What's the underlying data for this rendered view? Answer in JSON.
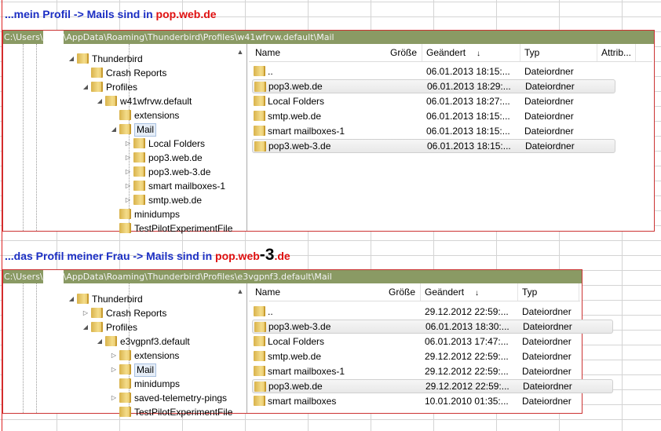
{
  "panels": [
    {
      "heading": {
        "text": "...mein Profil -> Mails sind in ",
        "highlight": "pop.web.de",
        "big": "",
        "tail": ""
      },
      "path": {
        "prefix": "C:\\Users\\",
        "suffix": "\\AppData\\Roaming\\Thunderbird\\Profiles\\w41wfrvw.default\\Mail"
      },
      "tree": [
        {
          "label": "Thunderbird",
          "level": 0,
          "arrow": "▲"
        },
        {
          "label": "Crash Reports",
          "level": 1,
          "arrow": ""
        },
        {
          "label": "Profiles",
          "level": 1,
          "arrow": "▲"
        },
        {
          "label": "w41wfrvw.default",
          "level": 2,
          "arrow": "▲"
        },
        {
          "label": "extensions",
          "level": 3,
          "arrow": ""
        },
        {
          "label": "Mail",
          "level": 3,
          "arrow": "▲",
          "selected": true
        },
        {
          "label": "Local Folders",
          "level": 4,
          "arrow": "▷"
        },
        {
          "label": "pop3.web.de",
          "level": 4,
          "arrow": "▷"
        },
        {
          "label": "pop3.web-3.de",
          "level": 4,
          "arrow": "▷"
        },
        {
          "label": "smart mailboxes-1",
          "level": 4,
          "arrow": "▷"
        },
        {
          "label": "smtp.web.de",
          "level": 4,
          "arrow": "▷"
        },
        {
          "label": "minidumps",
          "level": 3,
          "arrow": ""
        },
        {
          "label": "TestPilotExperimentFile",
          "level": 3,
          "arrow": ""
        }
      ],
      "columns": [
        "Name",
        "Größe",
        "Geändert",
        "Typ",
        "Attrib..."
      ],
      "sort_icon": "↓",
      "rows": [
        {
          "name": "..",
          "date": "06.01.2013 18:15:...",
          "type": "Dateiordner"
        },
        {
          "name": "pop3.web.de",
          "date": "06.01.2013 18:29:...",
          "type": "Dateiordner",
          "selected": true
        },
        {
          "name": "Local Folders",
          "date": "06.01.2013 18:27:...",
          "type": "Dateiordner"
        },
        {
          "name": "smtp.web.de",
          "date": "06.01.2013 18:15:...",
          "type": "Dateiordner"
        },
        {
          "name": "smart mailboxes-1",
          "date": "06.01.2013 18:15:...",
          "type": "Dateiordner"
        },
        {
          "name": "pop3.web-3.de",
          "date": "06.01.2013 18:15:...",
          "type": "Dateiordner",
          "selected": true
        }
      ]
    },
    {
      "heading": {
        "text": "...das Profil meiner Frau -> Mails sind in ",
        "highlight": "pop.web",
        "big": "-3",
        "tail": ".de"
      },
      "path": {
        "prefix": "C:\\Users\\",
        "suffix": "\\AppData\\Roaming\\Thunderbird\\Profiles\\e3vgpnf3.default\\Mail"
      },
      "tree": [
        {
          "label": "Thunderbird",
          "level": 0,
          "arrow": "▲"
        },
        {
          "label": "Crash Reports",
          "level": 1,
          "arrow": "▷"
        },
        {
          "label": "Profiles",
          "level": 1,
          "arrow": "▲"
        },
        {
          "label": "e3vgpnf3.default",
          "level": 2,
          "arrow": "▲"
        },
        {
          "label": "extensions",
          "level": 3,
          "arrow": "▷"
        },
        {
          "label": "Mail",
          "level": 3,
          "arrow": "▷",
          "selected": true
        },
        {
          "label": "minidumps",
          "level": 3,
          "arrow": ""
        },
        {
          "label": "saved-telemetry-pings",
          "level": 3,
          "arrow": "▷"
        },
        {
          "label": "TestPilotExperimentFile",
          "level": 3,
          "arrow": ""
        }
      ],
      "columns": [
        "Name",
        "Größe",
        "Geändert",
        "Typ"
      ],
      "sort_icon": "↓",
      "rows": [
        {
          "name": "..",
          "date": "29.12.2012 22:59:...",
          "type": "Dateiordner"
        },
        {
          "name": "pop3.web-3.de",
          "date": "06.01.2013 18:30:...",
          "type": "Dateiordner",
          "selected": true
        },
        {
          "name": "Local Folders",
          "date": "06.01.2013 17:47:...",
          "type": "Dateiordner"
        },
        {
          "name": "smtp.web.de",
          "date": "29.12.2012 22:59:...",
          "type": "Dateiordner"
        },
        {
          "name": "smart mailboxes-1",
          "date": "29.12.2012 22:59:...",
          "type": "Dateiordner"
        },
        {
          "name": "pop3.web.de",
          "date": "29.12.2012 22:59:...",
          "type": "Dateiordner",
          "selected": true
        },
        {
          "name": "smart mailboxes",
          "date": "10.01.2010 01:35:...",
          "type": "Dateiordner"
        }
      ]
    }
  ]
}
